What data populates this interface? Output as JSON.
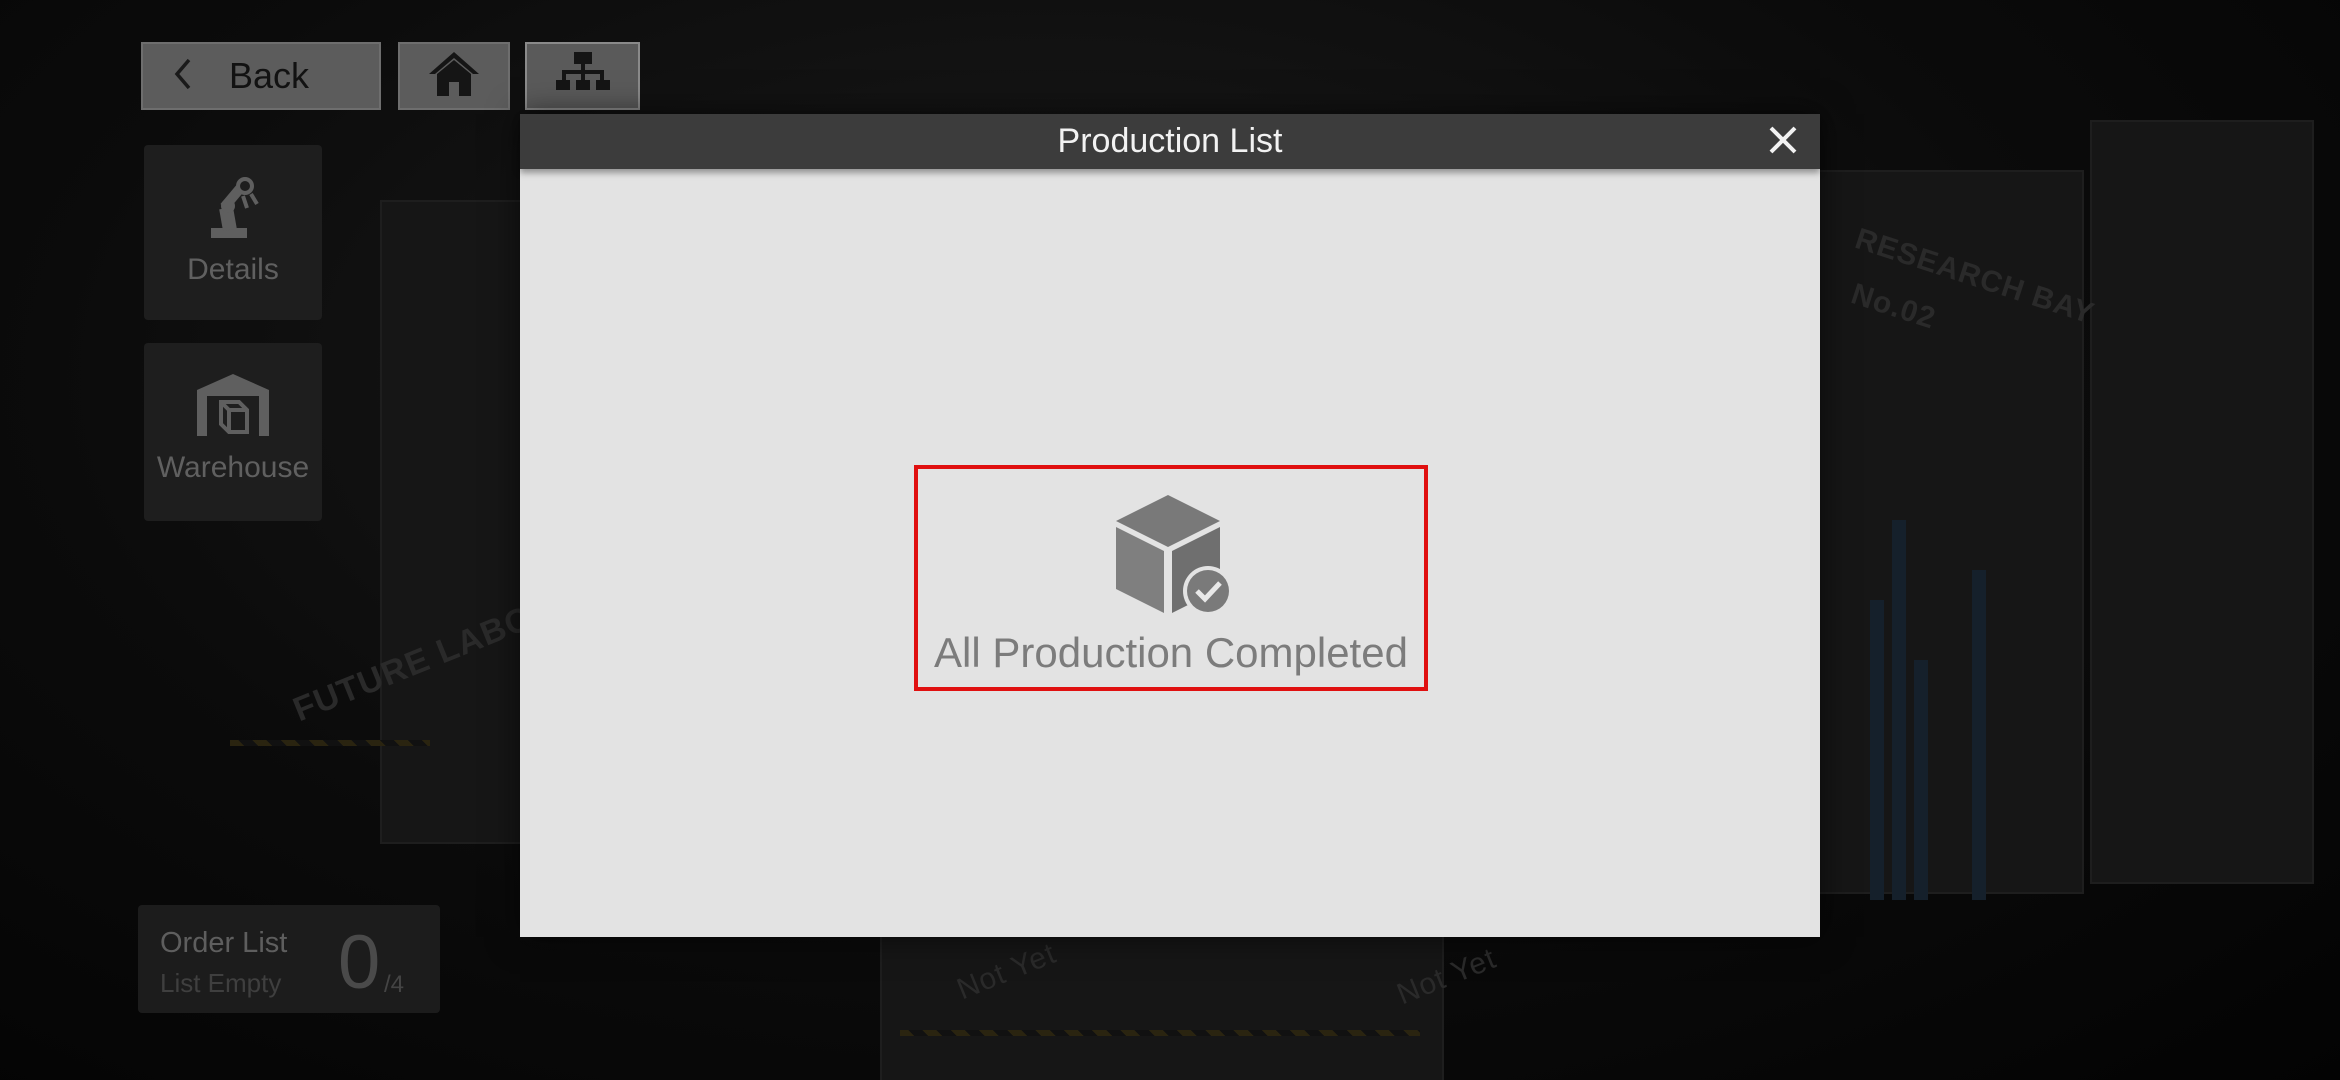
{
  "nav": {
    "back_label": "Back",
    "home_icon": "home-icon",
    "structure_icon": "sitemap-icon"
  },
  "side": {
    "details_label": "Details",
    "warehouse_label": "Warehouse"
  },
  "order": {
    "title": "Order List",
    "status": "List Empty",
    "count": "0",
    "max": "/4"
  },
  "modal": {
    "title": "Production List",
    "empty_message": "All Production Completed"
  },
  "background": {
    "labels": [
      "FUTURE LABOR",
      "RESEARCH BAY",
      "No.02",
      "Not Yet",
      "Not Yet"
    ]
  },
  "colors": {
    "header": "#3c3c3c",
    "modal_body": "#e3e3e3",
    "highlight": "#e01010"
  }
}
